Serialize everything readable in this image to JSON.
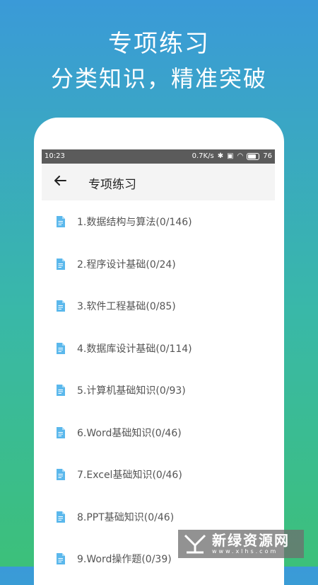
{
  "promo": {
    "title": "专项练习",
    "subtitle": "分类知识，精准突破"
  },
  "statusbar": {
    "time": "10:23",
    "speed": "0.7K/s",
    "battery": "76",
    "battery_level": 0.76
  },
  "appbar": {
    "title": "专项练习"
  },
  "items": [
    {
      "label": "1.数据结构与算法(0/146)"
    },
    {
      "label": "2.程序设计基础(0/24)"
    },
    {
      "label": "3.软件工程基础(0/85)"
    },
    {
      "label": "4.数据库设计基础(0/114)"
    },
    {
      "label": "5.计算机基础知识(0/93)"
    },
    {
      "label": "6.Word基础知识(0/46)"
    },
    {
      "label": "7.Excel基础知识(0/46)"
    },
    {
      "label": "8.PPT基础知识(0/46)"
    },
    {
      "label": "9.Word操作题(0/39)"
    }
  ],
  "watermark": {
    "text": "新绿资源网",
    "url": "www.xlhs.com"
  },
  "colors": {
    "icon": "#5bb8ec",
    "statusbar": "#5b5b5b",
    "appbar": "#f4f4f4"
  }
}
